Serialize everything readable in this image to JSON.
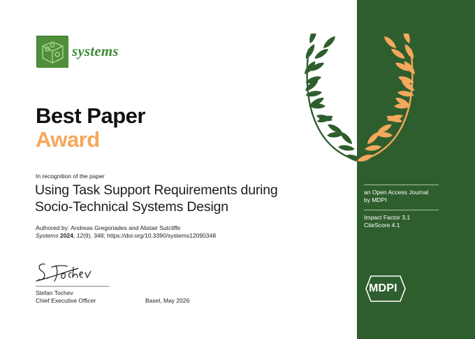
{
  "journal": {
    "name": "systems",
    "logo_icon": "puzzle-cube-logo-icon"
  },
  "award": {
    "title_line1": "Best Paper",
    "title_line2": "Award"
  },
  "recognition": "In recognition of the paper",
  "paper": {
    "title_line1": "Using Task Support Requirements during",
    "title_line2": "Socio-Technical Systems Design"
  },
  "authors": "Authored by: Andreas Gregoriades and Alistair Sutcliffe",
  "citation": {
    "journal": "Systems",
    "year": "2024",
    "volume_issue_pre": ", ",
    "volume": "12",
    "issue_pages": "(9), 348; https://doi.org/10.3390/systems12090348"
  },
  "signatory": {
    "signature_text": "S. Tochev",
    "name": "Stefan Tochev",
    "title": "Chief Executive Officer"
  },
  "place_date": "Basel, May 2026",
  "sidebar": {
    "open_access_line1": "an Open Access Journal",
    "open_access_line2": "by MDPI",
    "impact_factor": "Impact Factor 3.1",
    "cite_score": "CiteScore 4.1",
    "publisher_logo_text": "MDPI"
  },
  "colors": {
    "green_panel": "#2f5e2e",
    "accent_orange": "#f5a85b",
    "logo_green": "#4f8f3b",
    "wreath_green": "#2f5e2e"
  }
}
